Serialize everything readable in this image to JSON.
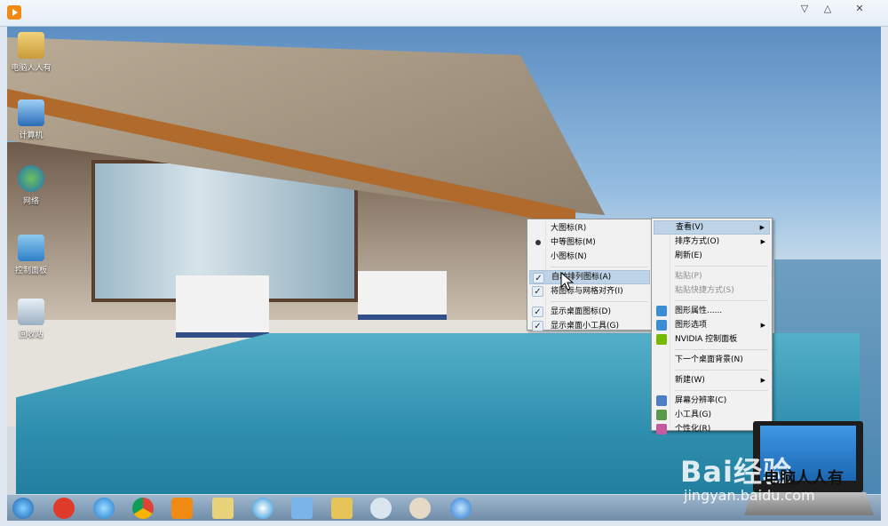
{
  "desktop_icons": [
    {
      "label": "电脑人人有",
      "icon": "user-folder-icon"
    },
    {
      "label": "计算机",
      "icon": "computer-icon"
    },
    {
      "label": "网络",
      "icon": "network-globe-icon"
    },
    {
      "label": "控制面板",
      "icon": "control-panel-icon"
    },
    {
      "label": "回收站",
      "icon": "recycle-bin-icon"
    }
  ],
  "view_submenu": [
    {
      "label": "大图标(R)",
      "mark": "none"
    },
    {
      "label": "中等图标(M)",
      "mark": "radio"
    },
    {
      "label": "小图标(N)",
      "mark": "none"
    },
    {
      "label": "自动排列图标(A)",
      "mark": "check",
      "highlighted": true
    },
    {
      "label": "将图标与网格对齐(I)",
      "mark": "check"
    },
    {
      "label": "显示桌面图标(D)",
      "mark": "check"
    },
    {
      "label": "显示桌面小工具(G)",
      "mark": "check"
    }
  ],
  "desktop_menu": {
    "view": "查看(V)",
    "sort": "排序方式(O)",
    "refresh": "刷新(E)",
    "paste": "粘贴(P)",
    "paste_shortcut": "粘贴快捷方式(S)",
    "graphics_properties": "图形属性......",
    "graphics_options": "图形选项",
    "nvidia": "NVIDIA 控制面板",
    "next_background": "下一个桌面背景(N)",
    "new": "新建(W)",
    "resolution": "屏幕分辨率(C)",
    "gadgets": "小工具(G)",
    "personalize": "个性化(R)"
  },
  "watermark": {
    "brand": "Bai经验",
    "url": "jingyan.baidu.com",
    "tag": "电脑人人有"
  },
  "colors": {
    "menu_highlight": "#bfd3e6",
    "taskbar": "#7f9bb6",
    "pool": "#2f8fae"
  }
}
